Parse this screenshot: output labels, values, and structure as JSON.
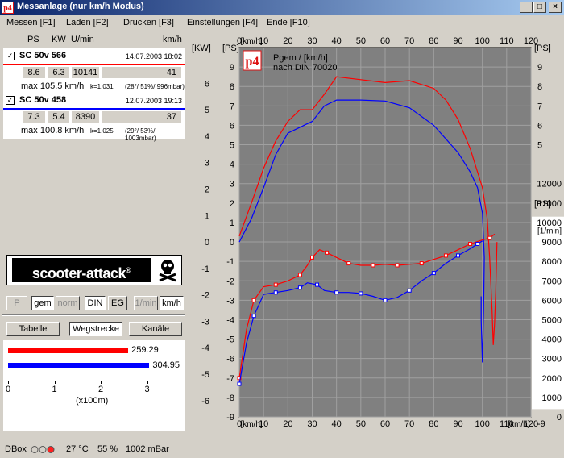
{
  "window": {
    "title": "Messanlage (nur km/h Modus)",
    "icon_text": "p4"
  },
  "menu": [
    "Messen [F1]",
    "Laden [F2]",
    "Drucken [F3]",
    "Einstellungen [F4]",
    "Ende [F10]"
  ],
  "headers": {
    "ps": "PS",
    "kw": "KW",
    "rpm": "U/min",
    "kmh": "km/h"
  },
  "entries": [
    {
      "name": "SC 50v 566",
      "date": "14.07.2003 18:02",
      "ps": "8.6",
      "kw": "6.3",
      "rpm": "10141",
      "kmh": "41",
      "max": "max 105.5 km/h",
      "k": "k=1.031",
      "cond": "(28°/ 51%/ 996mbar)",
      "color": "#ff0000"
    },
    {
      "name": "SC 50v 458",
      "date": "12.07.2003 19:13",
      "ps": "7.3",
      "kw": "5.4",
      "rpm": "8390",
      "kmh": "37",
      "max": "max 100.8 km/h",
      "k": "k=1.025",
      "cond": "(29°/ 53%/ 1003mbar)",
      "color": "#0000ff"
    }
  ],
  "logo": {
    "text": "scooter-attack",
    "reg": "®"
  },
  "toggles": [
    "P",
    "gem",
    "norm",
    "DIN",
    "EG",
    "1/min",
    "km/h"
  ],
  "tabs": [
    "Tabelle",
    "Wegstrecke",
    "Kanäle"
  ],
  "distances": {
    "red": "259.29",
    "blue": "304.95",
    "red_value": 2.5929,
    "blue_value": 3.0495,
    "x_ticks": [
      "0",
      "1",
      "2",
      "3"
    ],
    "x_label": "(x100m)"
  },
  "status": {
    "dbox": "DBox",
    "temp": "27 °C",
    "humidity": "55 %",
    "pressure": "1002 mBar"
  },
  "chart_data": {
    "type": "line",
    "annotation": [
      "Pgem / [km/h]",
      "nach DIN 70020"
    ],
    "logo_text": "p4",
    "x_axis": {
      "label": "[km/h]",
      "range": [
        0,
        120
      ],
      "ticks": [
        0,
        10,
        20,
        30,
        40,
        50,
        60,
        70,
        80,
        90,
        100,
        110,
        120
      ]
    },
    "left_axis": {
      "unit_kw": "[KW]",
      "unit_ps": "[PS]",
      "range": [
        -9,
        10
      ],
      "kw_ticks": [
        6,
        5,
        4,
        3,
        2,
        1,
        0,
        -1,
        -2,
        -3,
        -4,
        -5,
        -6
      ],
      "ps_ticks": [
        9,
        8,
        7,
        6,
        5,
        4,
        3,
        2,
        1,
        0,
        -1,
        -2,
        -3,
        -4,
        -5,
        -6,
        -7,
        -8,
        -9
      ]
    },
    "right_axis": {
      "unit_ps": "[PS]",
      "unit_rpm": "[1/min]",
      "ps_ticks": [
        9,
        8,
        7,
        6,
        5
      ],
      "rpm_ticks": [
        12000,
        11000,
        10000,
        9000,
        8000,
        7000,
        6000,
        5000,
        4000,
        3000,
        2000,
        1000,
        0
      ],
      "rpm_ps_offset": [
        -9,
        12000
      ]
    },
    "grid": true,
    "background": "#808080",
    "series": [
      {
        "color": "#ff0000",
        "kind": "power",
        "points": [
          [
            0,
            0.3
          ],
          [
            5,
            2
          ],
          [
            10,
            3.8
          ],
          [
            15,
            5.2
          ],
          [
            20,
            6.2
          ],
          [
            25,
            6.8
          ],
          [
            30,
            6.8
          ],
          [
            35,
            7.6
          ],
          [
            40,
            8.5
          ],
          [
            50,
            8.35
          ],
          [
            60,
            8.2
          ],
          [
            70,
            8.3
          ],
          [
            80,
            7.9
          ],
          [
            85,
            7.3
          ],
          [
            90,
            6.3
          ],
          [
            95,
            4.8
          ],
          [
            100,
            2.8
          ],
          [
            102,
            1.2
          ],
          [
            103,
            -0.8
          ],
          [
            104,
            -3.5
          ],
          [
            104.5,
            -5.3
          ],
          [
            105,
            -4.2
          ],
          [
            105.5,
            -2.5
          ],
          [
            106,
            0
          ]
        ]
      },
      {
        "color": "#0000ff",
        "kind": "power",
        "points": [
          [
            0,
            0
          ],
          [
            5,
            1.2
          ],
          [
            10,
            2.8
          ],
          [
            15,
            4.5
          ],
          [
            20,
            5.6
          ],
          [
            25,
            5.9
          ],
          [
            30,
            6.2
          ],
          [
            35,
            7
          ],
          [
            40,
            7.3
          ],
          [
            50,
            7.3
          ],
          [
            60,
            7.25
          ],
          [
            70,
            6.9
          ],
          [
            80,
            6
          ],
          [
            90,
            4.6
          ],
          [
            95,
            3.6
          ],
          [
            98,
            2.8
          ],
          [
            100,
            1.5
          ],
          [
            100.8,
            -0.8
          ],
          [
            100.5,
            -3.5
          ],
          [
            100,
            -6.2
          ],
          [
            99.5,
            -4
          ],
          [
            99.5,
            -2.8
          ]
        ]
      },
      {
        "color": "#ff0000",
        "kind": "rpm",
        "points": [
          [
            0,
            -7
          ],
          [
            3,
            -4.5
          ],
          [
            6,
            -3
          ],
          [
            10,
            -2.3
          ],
          [
            15,
            -2.2
          ],
          [
            20,
            -2
          ],
          [
            25,
            -1.7
          ],
          [
            28,
            -1.2
          ],
          [
            30,
            -0.8
          ],
          [
            33,
            -0.4
          ],
          [
            36,
            -0.55
          ],
          [
            40,
            -0.8
          ],
          [
            45,
            -1.1
          ],
          [
            50,
            -1.2
          ],
          [
            55,
            -1.2
          ],
          [
            60,
            -1.15
          ],
          [
            65,
            -1.2
          ],
          [
            70,
            -1.15
          ],
          [
            75,
            -1.1
          ],
          [
            80,
            -0.9
          ],
          [
            85,
            -0.7
          ],
          [
            90,
            -0.4
          ],
          [
            95,
            -0.1
          ],
          [
            100,
            0.1
          ],
          [
            103,
            0.2
          ],
          [
            105,
            0.4
          ]
        ]
      },
      {
        "color": "#0000ff",
        "kind": "rpm",
        "points": [
          [
            0,
            -7.3
          ],
          [
            3,
            -5.2
          ],
          [
            6,
            -3.8
          ],
          [
            10,
            -2.7
          ],
          [
            15,
            -2.6
          ],
          [
            20,
            -2.5
          ],
          [
            25,
            -2.35
          ],
          [
            28,
            -2.1
          ],
          [
            32,
            -2.2
          ],
          [
            35,
            -2.5
          ],
          [
            40,
            -2.6
          ],
          [
            45,
            -2.6
          ],
          [
            50,
            -2.65
          ],
          [
            55,
            -2.8
          ],
          [
            60,
            -3
          ],
          [
            65,
            -2.85
          ],
          [
            70,
            -2.5
          ],
          [
            75,
            -2
          ],
          [
            80,
            -1.6
          ],
          [
            85,
            -1.1
          ],
          [
            90,
            -0.7
          ],
          [
            95,
            -0.35
          ],
          [
            98,
            -0.1
          ],
          [
            100,
            0.05
          ]
        ]
      }
    ]
  }
}
